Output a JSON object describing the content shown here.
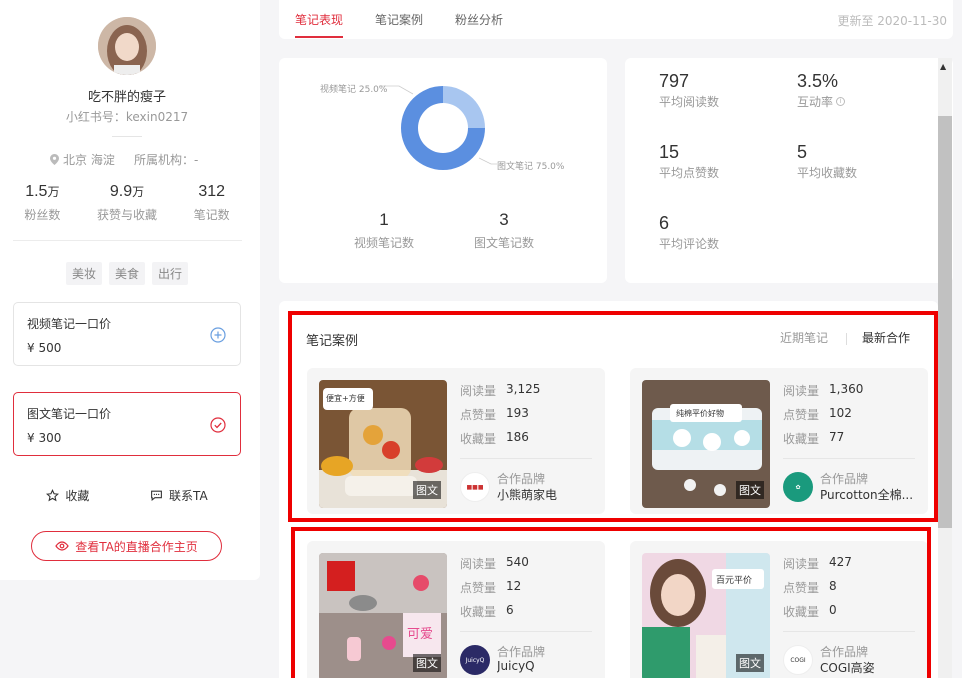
{
  "profile": {
    "name": "吃不胖的瘦子",
    "id_label": "小红书号：kexin0217",
    "location": "北京 海淀",
    "org": "所属机构：-",
    "stats": [
      {
        "num": "1.5",
        "unit": "万",
        "label": "粉丝数"
      },
      {
        "num": "9.9",
        "unit": "万",
        "label": "获赞与收藏"
      },
      {
        "num": "312",
        "unit": "",
        "label": "笔记数"
      }
    ],
    "tags": [
      "美妆",
      "美食",
      "出行"
    ],
    "video_price": {
      "title": "视频笔记一口价",
      "value": "¥ 500"
    },
    "image_price": {
      "title": "图文笔记一口价",
      "value": "¥ 300"
    },
    "favorite_label": "收藏",
    "contact_label": "联系TA",
    "live_button": "查看TA的直播合作主页"
  },
  "tabs": [
    "笔记表现",
    "笔记案例",
    "粉丝分析"
  ],
  "active_tab": 0,
  "updated": "更新至 2020-11-30",
  "donut": {
    "video_label": "视频笔记 25.0%",
    "image_label": "图文笔记 75.0%",
    "video_count": "1",
    "video_count_label": "视频笔记数",
    "image_count": "3",
    "image_count_label": "图文笔记数"
  },
  "chart_data": {
    "type": "pie",
    "categories": [
      "视频笔记",
      "图文笔记"
    ],
    "values": [
      25.0,
      75.0
    ],
    "colors": [
      "#a8c6f0",
      "#5b8fe0"
    ],
    "title": ""
  },
  "metrics": [
    {
      "num": "797",
      "label": "平均阅读数"
    },
    {
      "num": "3.5%",
      "label": "互动率"
    },
    {
      "num": "15",
      "label": "平均点赞数"
    },
    {
      "num": "5",
      "label": "平均收藏数"
    },
    {
      "num": "6",
      "label": "平均评论数"
    }
  ],
  "notes": {
    "title": "笔记案例",
    "filter_recent": "近期笔记",
    "filter_collab": "最新合作",
    "stat_labels": [
      "阅读量",
      "点赞量",
      "收藏量"
    ],
    "brand_label": "合作品牌",
    "type_tag": "图文",
    "items": [
      {
        "reads": "3,125",
        "likes": "193",
        "saves": "186",
        "brand": "小熊萌家电",
        "thumb_text": "便宜+方便"
      },
      {
        "reads": "1,360",
        "likes": "102",
        "saves": "77",
        "brand": "Purcotton全棉...",
        "thumb_text": "纯棉平价好物"
      },
      {
        "reads": "540",
        "likes": "12",
        "saves": "6",
        "brand": "JuicyQ",
        "thumb_text": "可爱"
      },
      {
        "reads": "427",
        "likes": "8",
        "saves": "0",
        "brand": "COGI高姿",
        "thumb_text": "百元平价"
      }
    ]
  },
  "accent_color": "#e02e3d"
}
